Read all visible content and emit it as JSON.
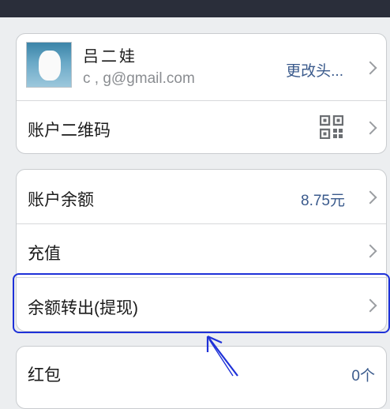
{
  "profile": {
    "name": "吕二娃",
    "email": "c          ,         g@gmail.com",
    "change_avatar_label": "更改头..."
  },
  "qr_row": {
    "label": "账户二维码"
  },
  "balance_row": {
    "label": "账户余额",
    "value": "8.75元"
  },
  "recharge_row": {
    "label": "充值"
  },
  "withdraw_row": {
    "label": "余额转出(提现)"
  },
  "redpacket_row": {
    "label": "红包",
    "value": "0个"
  },
  "colors": {
    "accent": "#3a5a8c",
    "annotation": "#1e31d8",
    "topbar": "#2a2e3a"
  },
  "icons": [
    "chevron-right-icon",
    "qr-code-icon",
    "annotation-arrow-icon"
  ]
}
